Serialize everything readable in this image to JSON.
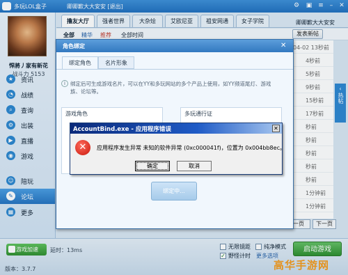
{
  "app": {
    "title": "多玩LOL盒子",
    "user": "卿卿歉大大安安 [退出]"
  },
  "profile": {
    "nickname": "悍將丿家有新花",
    "power": "战斗力 5153"
  },
  "sidebar": {
    "items": [
      {
        "label": "资讯",
        "icon": "star-icon"
      },
      {
        "label": "战绩",
        "icon": "chart-icon"
      },
      {
        "label": "查询",
        "icon": "search-icon"
      },
      {
        "label": "出装",
        "icon": "gear-icon"
      },
      {
        "label": "直播",
        "icon": "play-icon"
      },
      {
        "label": "游戏",
        "icon": "game-icon"
      },
      {
        "label": "陪玩",
        "icon": "person-icon"
      },
      {
        "label": "论坛",
        "icon": "forum-icon"
      },
      {
        "label": "更多",
        "icon": "grid-icon"
      }
    ]
  },
  "tabs": [
    "撸友大厅",
    "强者世界",
    "大杂烩",
    "艾欧尼亚",
    "祖安网通",
    "女子学院"
  ],
  "right_user": "卿卿歉大大安安",
  "filters": [
    "全部",
    "精华",
    "推荐",
    "全部时间"
  ],
  "post_button": "发表新帖",
  "list_times": [
    "04-02 13秒前",
    "4秒前",
    "5秒前",
    "9秒前",
    "15秒前",
    "17秒前",
    "秒前",
    "秒前",
    "秒前",
    "秒前",
    "秒前",
    "1分钟前",
    "1分钟前"
  ],
  "hot_label": "热帖",
  "pager": {
    "prev": "一页",
    "next": "下一页"
  },
  "bottom": {
    "speed": "游戏加速",
    "latency": "延时：13ms",
    "version": "版本：3.7.7",
    "start": "启动游戏",
    "more": "更多选项"
  },
  "options": [
    {
      "label": "无限镜距",
      "checked": false
    },
    {
      "label": "纯净模式",
      "checked": false
    },
    {
      "label": "野怪计时",
      "checked": true
    }
  ],
  "watermark": "高华手游网",
  "role_dialog": {
    "title": "角色绑定",
    "tabs": [
      "绑定角色",
      "名片形象"
    ],
    "desc": "绑定后可生成游戏名片，可以在YY和多玩网站的多个产品上使用，如YY频道尾灯、游戏族、论坛等。",
    "box1": "游戏角色",
    "box2": "多玩通行证",
    "bind_button": "绑定中..."
  },
  "error_dialog": {
    "title": "AccountBind.exe - 应用程序错误",
    "message": "应用程序发生异常 未知的软件异常 (0xc000041f)，位置为 0x004bb8ec。",
    "ok": "确定",
    "cancel": "取消"
  }
}
